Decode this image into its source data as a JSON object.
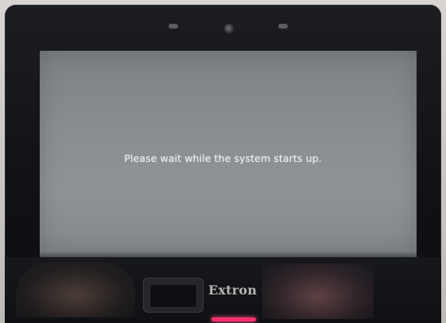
{
  "screen": {
    "message": "Please wait while the system starts up."
  },
  "device": {
    "brand": "Extron",
    "led_color": "#ff2f6e"
  },
  "colors": {
    "bezel": "#111216",
    "screen": "#8a8d91",
    "message_text": "#f2f4f7"
  }
}
